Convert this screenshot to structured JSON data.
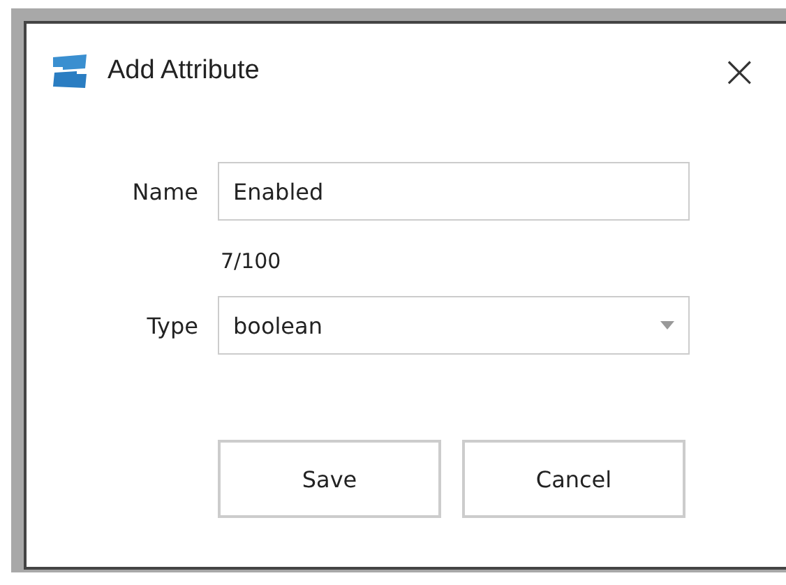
{
  "window": {
    "title": "Add Attribute",
    "close": "×"
  },
  "form": {
    "name_label": "Name",
    "name_value": "Enabled",
    "counter": "7/100",
    "type_label": "Type",
    "type_value": "boolean"
  },
  "buttons": [
    {
      "label": "Save"
    },
    {
      "label": "Cancel"
    }
  ]
}
